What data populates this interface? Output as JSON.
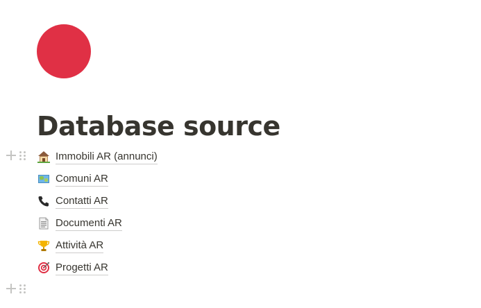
{
  "page": {
    "title": "Database source",
    "icon": "red-circle-icon",
    "icon_color": "#e03045"
  },
  "links": [
    {
      "icon": "house-icon",
      "label": "Immobili AR (annunci)"
    },
    {
      "icon": "map-icon",
      "label": "Comuni AR"
    },
    {
      "icon": "telephone-icon",
      "label": "Contatti AR"
    },
    {
      "icon": "document-icon",
      "label": "Documenti AR"
    },
    {
      "icon": "trophy-icon",
      "label": "Attività AR"
    },
    {
      "icon": "target-icon",
      "label": "Progetti AR"
    }
  ]
}
